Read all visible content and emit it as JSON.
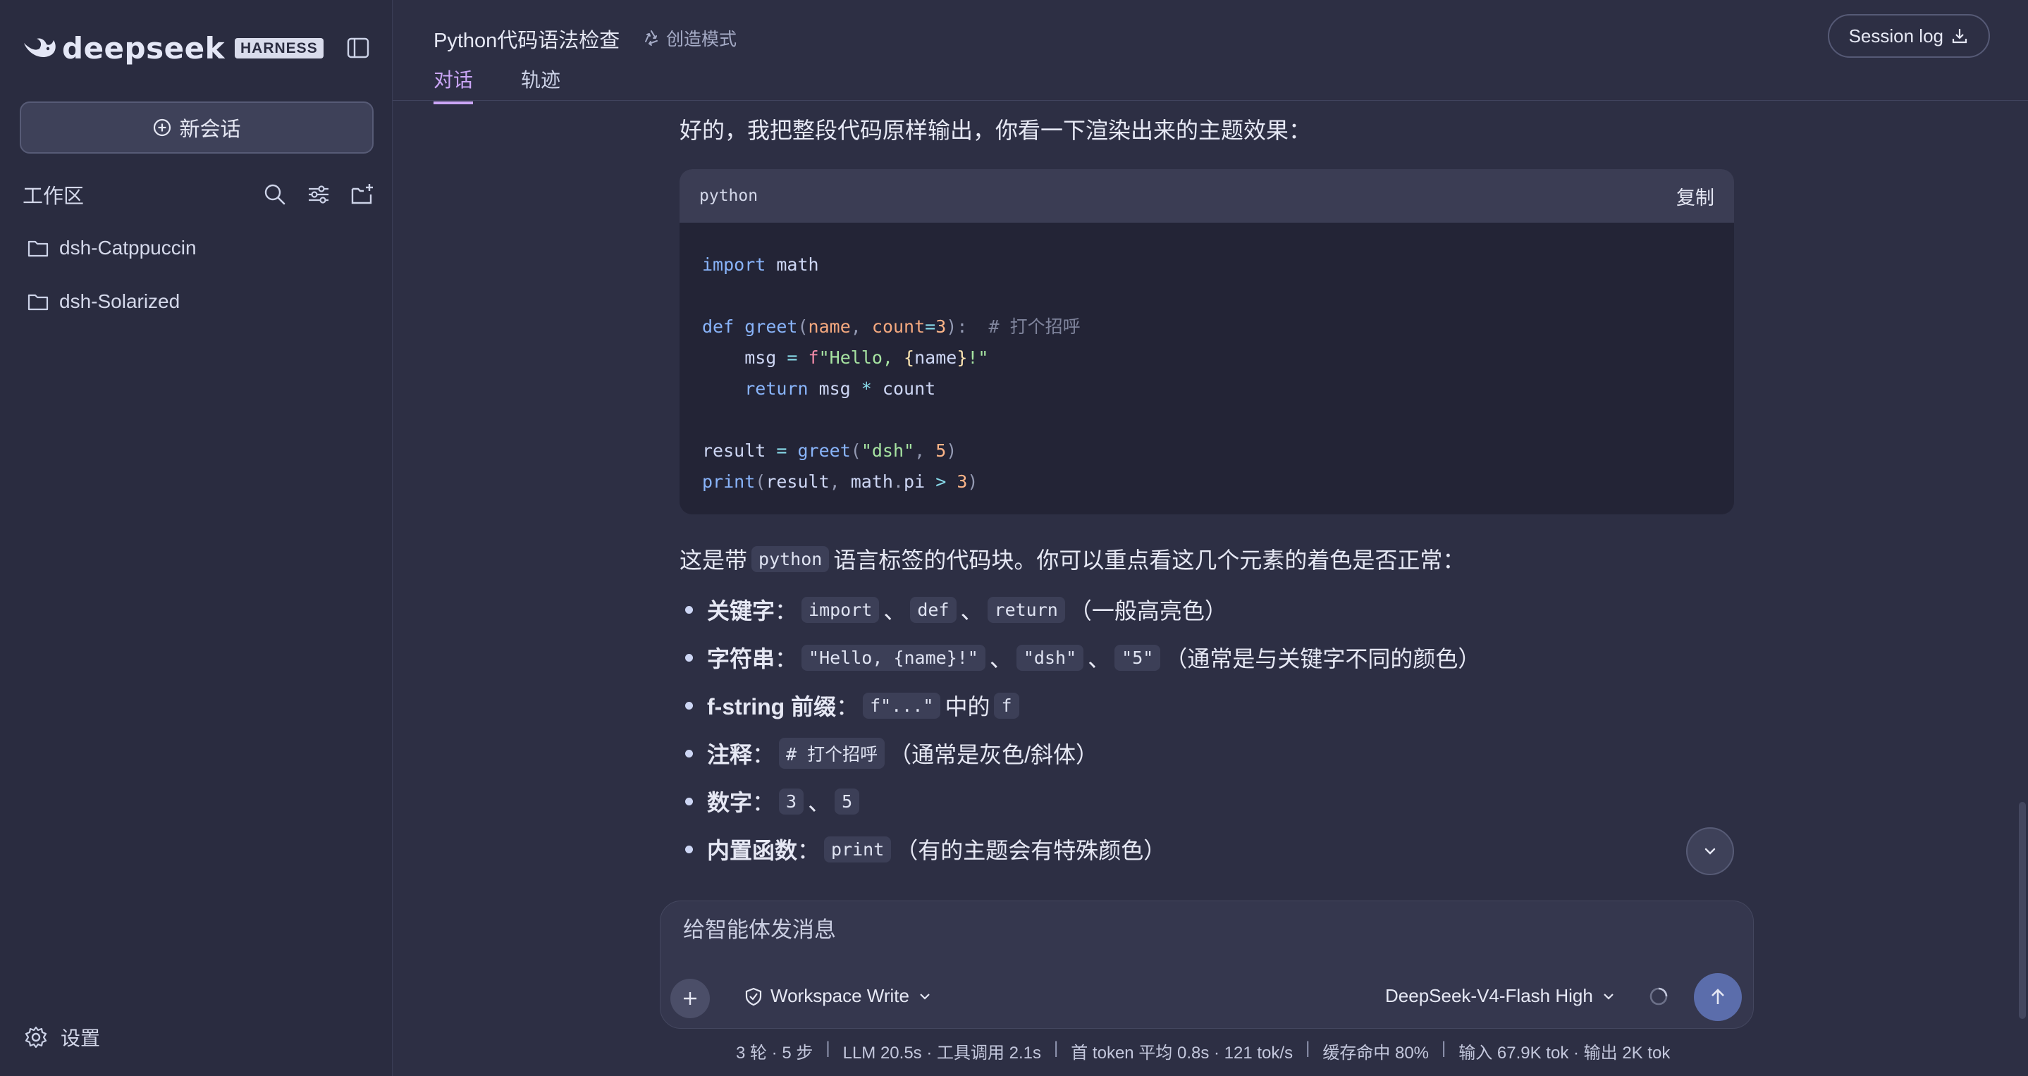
{
  "brand": {
    "name": "deepseek",
    "badge": "HARNESS"
  },
  "sidebar": {
    "new_chat_label": "新会话",
    "workspace_title": "工作区",
    "folders": [
      {
        "label": "dsh-Catppuccin"
      },
      {
        "label": "dsh-Solarized"
      }
    ],
    "settings_label": "设置"
  },
  "header": {
    "title": "Python代码语法检查",
    "mode": "创造模式",
    "tabs": [
      {
        "label": "对话",
        "active": true
      },
      {
        "label": "轨迹",
        "active": false
      }
    ],
    "session_log_label": "Session log"
  },
  "message": {
    "intro": "好的，我把整段代码原样输出，你看一下渲染出来的主题效果：",
    "code": {
      "language": "python",
      "copy_label": "复制",
      "lines": [
        "import math",
        "",
        "def greet(name, count=3):  # 打个招呼",
        "    msg = f\"Hello, {name}!\"",
        "    return msg * count",
        "",
        "result = greet(\"dsh\", 5)",
        "print(result, math.pi > 3)"
      ]
    },
    "desc_before": "这是带",
    "desc_code": "python",
    "desc_after": "语言标签的代码块。你可以重点看这几个元素的着色是否正常：",
    "bullets": [
      {
        "label": "关键字",
        "colon": "：",
        "codes": [
          "import",
          "def",
          "return"
        ],
        "sep": "、",
        "note": "（一般高亮色）"
      },
      {
        "label": "字符串",
        "colon": "：",
        "codes": [
          "\"Hello, {name}!\"",
          "\"dsh\"",
          "\"5\""
        ],
        "sep": "、",
        "note": "（通常是与关键字不同的颜色）"
      },
      {
        "label": "f-string 前缀",
        "colon": "：",
        "codes": [
          "f\"...\""
        ],
        "mid": "中的",
        "codes2": [
          "f"
        ]
      },
      {
        "label": "注释",
        "colon": "：",
        "codes": [
          "# 打个招呼"
        ],
        "note": "（通常是灰色/斜体）"
      },
      {
        "label": "数字",
        "colon": "：",
        "codes": [
          "3",
          "5"
        ],
        "sep": "、"
      },
      {
        "label": "内置函数",
        "colon": "：",
        "codes": [
          "print"
        ],
        "note": "（有的主题会有特殊颜色）"
      }
    ]
  },
  "composer": {
    "placeholder": "给智能体发消息",
    "workspace_mode": "Workspace Write",
    "model": "DeepSeek-V4-Flash High"
  },
  "status_bar": {
    "items": [
      "3 轮 · 5 步",
      "LLM 20.5s · 工具调用 2.1s",
      "首 token 平均 0.8s · 121 tok/s",
      "缓存命中 80%",
      "输入 67.9K tok · 输出 2K tok"
    ],
    "separator": "|"
  },
  "colors": {
    "accent": "#cba6f7",
    "send": "#5b6dab",
    "background": "#2d2f44",
    "sidebar": "#2a2c40"
  }
}
